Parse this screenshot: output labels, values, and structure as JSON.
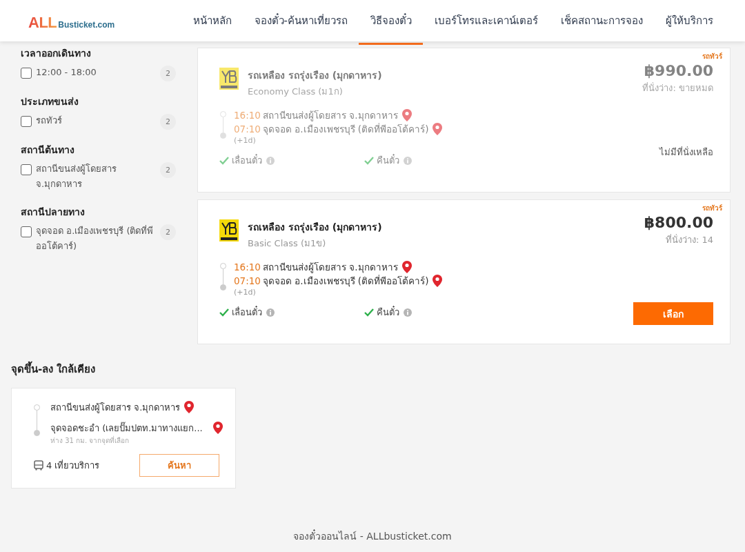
{
  "header": {
    "logo": {
      "brand": "ALL",
      "domain": "Busticket.com"
    },
    "nav": [
      {
        "label": "หน้าหลัก",
        "selected": false
      },
      {
        "label": "จองตั๋ว-ค้นหาเที่ยวรถ",
        "selected": false
      },
      {
        "label": "วิธีจองตั๋ว",
        "selected": true
      },
      {
        "label": "เบอร์โทรและเคาน์เตอร์",
        "selected": false
      },
      {
        "label": "เช็คสถานะการจอง",
        "selected": false
      },
      {
        "label": "ผู้ให้บริการ",
        "selected": false
      }
    ]
  },
  "filters": [
    {
      "title": "เวลาออกเดินทาง",
      "options": [
        {
          "label": "12:00 - 18:00",
          "count": "2",
          "checked": false
        }
      ]
    },
    {
      "title": "ประเภทขนส่ง",
      "options": [
        {
          "label": "รถทัวร์",
          "count": "2",
          "checked": false
        }
      ]
    },
    {
      "title": "สถานีต้นทาง",
      "options": [
        {
          "label": "สถานีขนส่งผู้โดยสาร จ.มุกดาหาร",
          "count": "2",
          "checked": false
        }
      ]
    },
    {
      "title": "สถานีปลายทาง",
      "options": [
        {
          "label": "จุดจอด อ.เมืองเพชรบุรี (ติดที่พีออโต้คาร์)",
          "count": "2",
          "checked": false
        }
      ]
    }
  ],
  "trips": [
    {
      "sold_out": true,
      "tag": "รถทัวร์",
      "operator": "รถเหลือง รถรุ่งเรือง (มุกดาหาร)",
      "bus_class": "Economy Class (ม1ก)",
      "price": "฿990.00",
      "seats": "ที่นั่งว่าง: ขายหมด",
      "depart": {
        "time": "16:10",
        "station": "สถานีขนส่งผู้โดยสาร จ.มุกดาหาร"
      },
      "arrive": {
        "time": "07:10",
        "station": "จุดจอด อ.เมืองเพชรบุรี (ติดที่พีออโต้คาร์)",
        "day_offset": "(+1d)"
      },
      "policies": [
        "เลื่อนตั๋ว",
        "คืนตั๋ว"
      ],
      "action": {
        "kind": "status",
        "label": "ไม่มีที่นั่งเหลือ"
      }
    },
    {
      "sold_out": false,
      "tag": "รถทัวร์",
      "operator": "รถเหลือง รถรุ่งเรือง (มุกดาหาร)",
      "bus_class": "Basic Class (ม1ข)",
      "price": "฿800.00",
      "seats": "ที่นั่งว่าง: 14",
      "depart": {
        "time": "16:10",
        "station": "สถานีขนส่งผู้โดยสาร จ.มุกดาหาร"
      },
      "arrive": {
        "time": "07:10",
        "station": "จุดจอด อ.เมืองเพชรบุรี (ติดที่พีออโต้คาร์)",
        "day_offset": "(+1d)"
      },
      "policies": [
        "เลื่อนตั๋ว",
        "คืนตั๋ว"
      ],
      "action": {
        "kind": "button",
        "label": "เลือก"
      }
    }
  ],
  "nearby": {
    "title": "จุดขึ้น-ลง ใกล้เคียง",
    "routes": [
      {
        "from": "สถานีขนส่งผู้โดยสาร จ.มุกดาหาร",
        "to": "จุดจอดชะอำ (เลยปั๊มปตท.มาทางแยก...",
        "distance": "ห่าง 31 กม. จากจุดที่เลือก",
        "trips": "4 เที่ยวบริการ",
        "button": "ค้นหา"
      }
    ]
  },
  "footer": "จองตั๋วออนไลน์ - ALLbusticket.com"
}
